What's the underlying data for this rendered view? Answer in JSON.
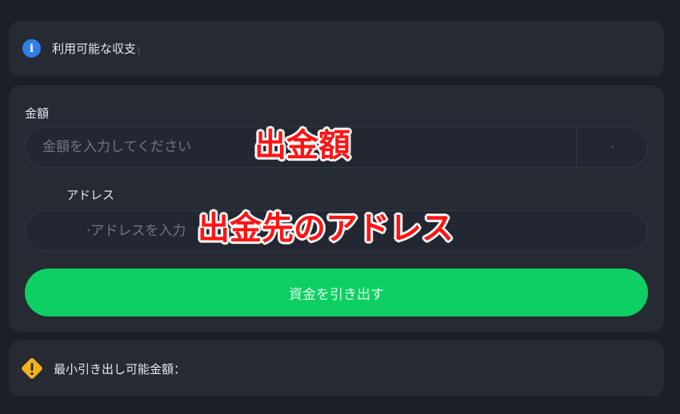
{
  "info": {
    "icon": "info-icon",
    "icon_glyph": "i",
    "text": "利用可能な収支"
  },
  "form": {
    "amount_label": "金額",
    "amount_placeholder": "金額を入力してください",
    "amount_suffix": "·",
    "address_label": "アドレス",
    "address_placeholder": "·アドレスを入力",
    "submit_label": "資金を引き出す"
  },
  "warning": {
    "icon": "warning-icon",
    "text": "最小引き出し可能金額："
  },
  "annotations": {
    "amount_note": "出金額",
    "address_note": "出金先のアドレス"
  },
  "colors": {
    "background": "#1b1f27",
    "card": "#252a33",
    "accent_green": "#0ecf63",
    "info_blue": "#2f7fe6",
    "warning_amber": "#f5b31b",
    "annotation_red": "#ff1414"
  }
}
